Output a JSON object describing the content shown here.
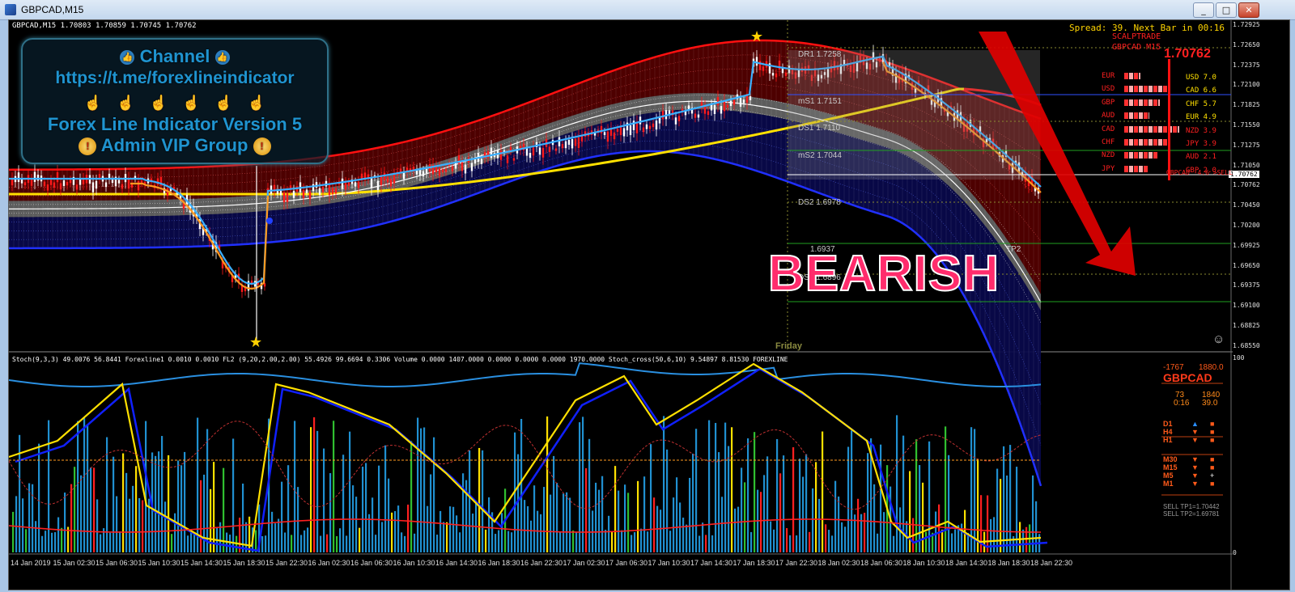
{
  "window": {
    "title": "GBPCAD,M15",
    "minimize": "_",
    "restore": "□",
    "close": "✕"
  },
  "ohlc_header": "GBPCAD,M15  1.70803 1.70859 1.70745 1.70762",
  "spread_text": "Spread: 39. Next Bar in 00:16",
  "scalptrade": {
    "line1": "SCALPTRADE",
    "line2": "GBPCAD M15"
  },
  "current_price": "1.70762",
  "price_marker": "1.70762",
  "promo": {
    "line1": "Channel",
    "line2": "https://t.me/forexlineindicator",
    "line4": "Forex Line Indicator Version 5",
    "line5": "Admin VIP Group",
    "hand_icon": "☝",
    "thumb_icon": "👍",
    "badge_icon": "!"
  },
  "bearish_label": "BEARISH",
  "levels": [
    {
      "name": "DR1",
      "value": "1.7258",
      "text": "DR1  1.7258"
    },
    {
      "name": "mS1",
      "value": "1.7151",
      "text": "mS1  1.7151"
    },
    {
      "name": "DS1",
      "value": "1.7110",
      "text": "DS1  1.7110"
    },
    {
      "name": "mS2",
      "value": "1.7044",
      "text": "mS2  1.7044"
    },
    {
      "name": "DS2",
      "value": "1.6978",
      "text": "DS2  1.6978"
    },
    {
      "name": "mS3",
      "value": "1.6937",
      "text": "1.6937"
    },
    {
      "name": "DS3",
      "value": "1.6896",
      "text": "DS3  1.6896"
    }
  ],
  "tp_label": "TP2",
  "friday_label": "Friday",
  "price_axis": [
    "1.72925",
    "1.72650",
    "1.72375",
    "1.72100",
    "1.71825",
    "1.71550",
    "1.71275",
    "1.71050",
    "1.70762",
    "1.70450",
    "1.70200",
    "1.69925",
    "1.69650",
    "1.69375",
    "1.69100",
    "1.68825",
    "1.68550"
  ],
  "time_axis": [
    "14 Jan 2019",
    "15 Jan 02:30",
    "15 Jan 06:30",
    "15 Jan 10:30",
    "15 Jan 14:30",
    "15 Jan 18:30",
    "15 Jan 22:30",
    "16 Jan 02:30",
    "16 Jan 06:30",
    "16 Jan 10:30",
    "16 Jan 14:30",
    "16 Jan 18:30",
    "16 Jan 22:30",
    "17 Jan 02:30",
    "17 Jan 06:30",
    "17 Jan 10:30",
    "17 Jan 14:30",
    "17 Jan 18:30",
    "17 Jan 22:30",
    "18 Jan 02:30",
    "18 Jan 06:30",
    "18 Jan 10:30",
    "18 Jan 14:30",
    "18 Jan 18:30",
    "18 Jan 22:30"
  ],
  "currency_strength": {
    "left": [
      "EUR",
      "USD",
      "GBP",
      "AUD",
      "CAD",
      "CHF",
      "NZD",
      "JPY"
    ],
    "right": [
      {
        "name": "USD",
        "value": "7.0"
      },
      {
        "name": "CAD",
        "value": "6.6"
      },
      {
        "name": "CHF",
        "value": "5.7"
      },
      {
        "name": "EUR",
        "value": "4.9"
      },
      {
        "name": "NZD",
        "value": "3.9"
      },
      {
        "name": "JPY",
        "value": "3.9"
      },
      {
        "name": "AUD",
        "value": "2.1"
      },
      {
        "name": "GBP",
        "value": "2.0"
      }
    ],
    "footer": "GBPCAD -4.6 >SELL"
  },
  "indicator_header": "Stoch(9,3,3) 49.0076 56.8441  Forexline1 0.0010 0.0010  FL2 (9,20,2.00,2.00) 55.4926 99.6694 0.3306  Volume 0.0000 1407.0000 0.0000 0.0000 0.0000 1970.0000  Stoch_cross(50,6,10) 9.54897 8.81530  FOREXLINE",
  "sub_axis": {
    "top": "100",
    "bottom": "0"
  },
  "right_panel": {
    "nums1": [
      "-1767",
      "1880.0"
    ],
    "symbol": "GBPCAD",
    "nums2": [
      "73",
      "1840"
    ],
    "nums3": [
      "0:16",
      "39.0"
    ],
    "timeframes": [
      {
        "tf": "D1",
        "dir": "up",
        "arrow": "▲",
        "sq": "■"
      },
      {
        "tf": "H4",
        "dir": "down",
        "arrow": "▼",
        "sq": "■"
      },
      {
        "tf": "H1",
        "dir": "down",
        "arrow": "▼",
        "sq": "■"
      },
      {
        "tf": "M30",
        "dir": "down",
        "arrow": "▼",
        "sq": "■"
      },
      {
        "tf": "M15",
        "dir": "down",
        "arrow": "▼",
        "sq": "■"
      },
      {
        "tf": "M5",
        "dir": "down",
        "arrow": "▼",
        "sq": "+"
      },
      {
        "tf": "M1",
        "dir": "down",
        "arrow": "▼",
        "sq": "■"
      }
    ],
    "sell_tp1": "SELL TP1=1.70442",
    "sell_tp2": "SELL TP2=1.69781"
  },
  "colors": {
    "bull": "#ffffff",
    "bear": "#ff2020",
    "accent": "#1f94d0",
    "yellow": "#ffe000"
  }
}
